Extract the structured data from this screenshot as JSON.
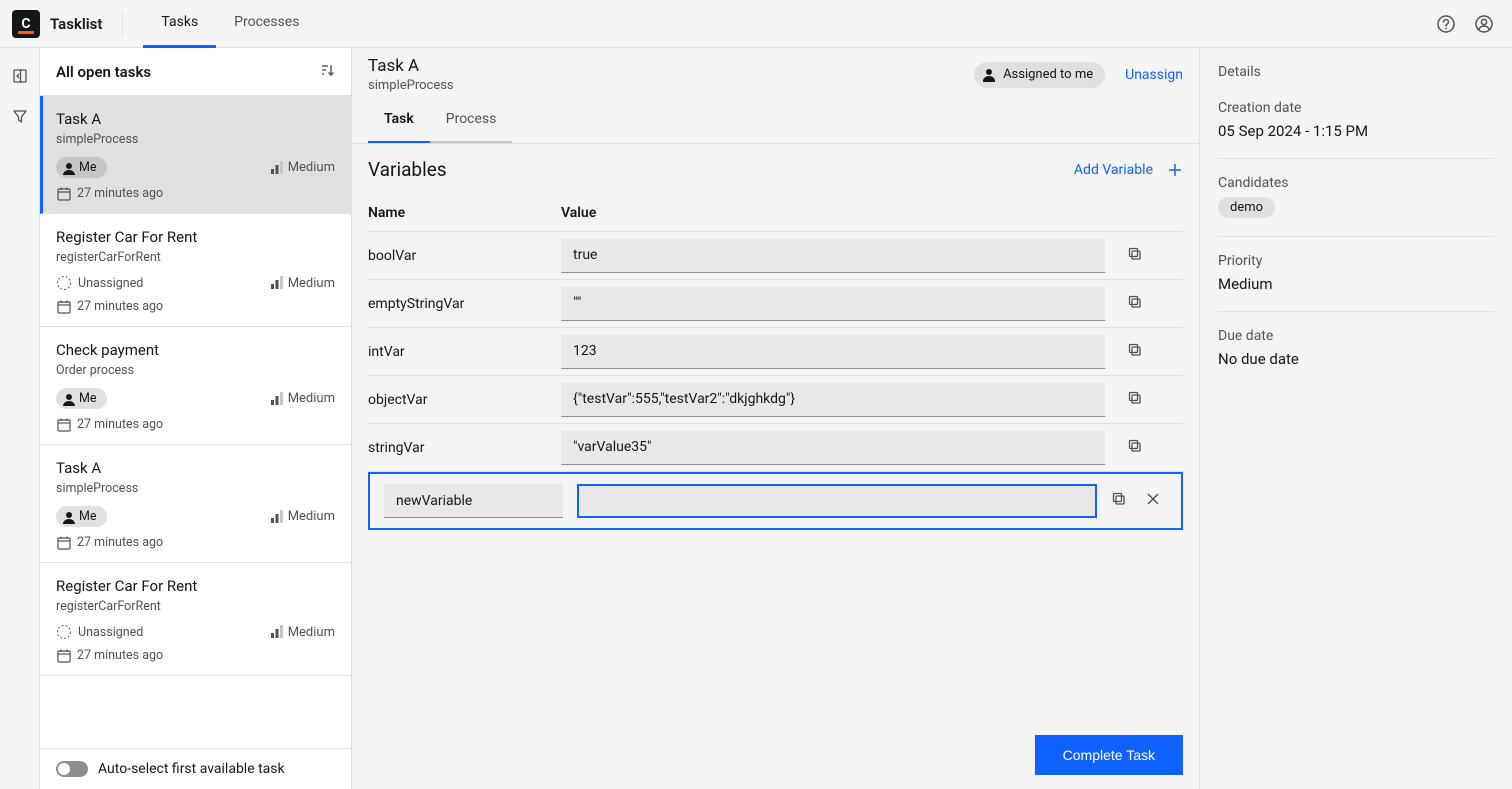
{
  "app": {
    "name": "Tasklist"
  },
  "topnav": {
    "tasks": "Tasks",
    "processes": "Processes"
  },
  "tasklist": {
    "header": "All open tasks",
    "footer_toggle": "Auto-select first available task",
    "items": [
      {
        "title": "Task A",
        "process": "simpleProcess",
        "assignee": "Me",
        "assigned": true,
        "priority": "Medium",
        "age": "27 minutes ago",
        "selected": true
      },
      {
        "title": "Register Car For Rent",
        "process": "registerCarForRent",
        "assignee": "Unassigned",
        "assigned": false,
        "priority": "Medium",
        "age": "27 minutes ago",
        "selected": false
      },
      {
        "title": "Check payment",
        "process": "Order process",
        "assignee": "Me",
        "assigned": true,
        "priority": "Medium",
        "age": "27 minutes ago",
        "selected": false
      },
      {
        "title": "Task A",
        "process": "simpleProcess",
        "assignee": "Me",
        "assigned": true,
        "priority": "Medium",
        "age": "27 minutes ago",
        "selected": false
      },
      {
        "title": "Register Car For Rent",
        "process": "registerCarForRent",
        "assignee": "Unassigned",
        "assigned": false,
        "priority": "Medium",
        "age": "27 minutes ago",
        "selected": false
      }
    ]
  },
  "task": {
    "title": "Task A",
    "process": "simpleProcess",
    "assigned_to": "Assigned to me",
    "unassign": "Unassign",
    "tabs": {
      "task": "Task",
      "process": "Process"
    },
    "vars_title": "Variables",
    "add_var": "Add Variable",
    "col_name": "Name",
    "col_value": "Value",
    "variables": [
      {
        "name": "boolVar",
        "value": "true"
      },
      {
        "name": "emptyStringVar",
        "value": "\"\""
      },
      {
        "name": "intVar",
        "value": "123"
      },
      {
        "name": "objectVar",
        "value": "{\"testVar\":555,\"testVar2\":\"dkjghkdg\"}"
      },
      {
        "name": "stringVar",
        "value": "\"varValue35\""
      }
    ],
    "new_var_name": "newVariable",
    "new_var_value": "",
    "complete": "Complete Task"
  },
  "details": {
    "title": "Details",
    "creation_label": "Creation date",
    "creation_value": "05 Sep 2024 - 1:15 PM",
    "candidates_label": "Candidates",
    "candidates_value": "demo",
    "priority_label": "Priority",
    "priority_value": "Medium",
    "due_label": "Due date",
    "due_value": "No due date"
  }
}
